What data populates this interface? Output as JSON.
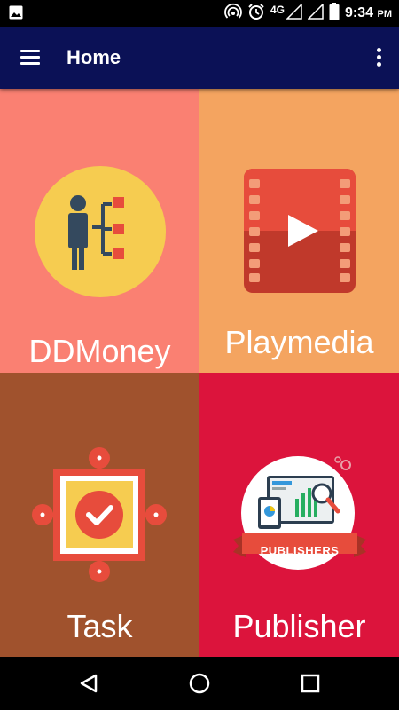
{
  "status_bar": {
    "network": "4G",
    "time": "9:34",
    "ampm": "PM"
  },
  "app_bar": {
    "title": "Home"
  },
  "tiles": [
    {
      "label": "DDMoney",
      "color": "#fa8072"
    },
    {
      "label": "Playmedia",
      "color": "#f4a460"
    },
    {
      "label": "Task",
      "color": "#a0522d"
    },
    {
      "label": "Publisher",
      "color": "#dc143c"
    }
  ],
  "publisher_banner": "PUBLISHERS",
  "icons": {
    "status": [
      "image-icon",
      "hotspot-icon",
      "alarm-icon",
      "signal-icon",
      "battery-icon"
    ],
    "nav": [
      "back-icon",
      "home-icon",
      "recents-icon"
    ]
  }
}
